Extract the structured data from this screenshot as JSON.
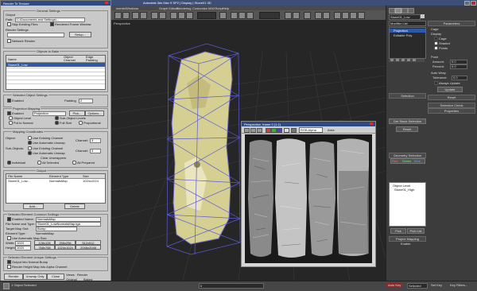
{
  "app": {
    "title": "Autodesk 3ds Max 9 SP2   |   Display   |   Stone01 3D",
    "title_prefix": "Stone01",
    "title_path": "ments\\Windows"
  },
  "menu": [
    "Graph Editors",
    "Rendering",
    "Customize",
    "MAXScript",
    "Help"
  ],
  "viewport": {
    "label": "Perspective"
  },
  "rtt": {
    "title": "Render To Texture",
    "general_settings": "General Settings",
    "output_label": "Output",
    "path_label": "Path:",
    "path_value": "C:\\Documents and Settings\\...",
    "skip_existing": "Skip Existing Files",
    "rendered_frame_window": "Rendered Frame Window",
    "render_settings": "Render Settings",
    "setup_btn": "Setup...",
    "network_render": "Network Render",
    "objects_to_bake": "Objects to Bake",
    "bake_headers": [
      "Name",
      "Object Channel",
      "Edge Padding"
    ],
    "bake_rows": [
      "Stone01_Low",
      "",
      "",
      "",
      "",
      ""
    ],
    "selected_obj_settings": "Selected Object Settings",
    "enabled": "Enabled",
    "padding_label": "Padding",
    "padding_value": "2",
    "projection_mapping": "Projection Mapping",
    "projection_label": "Projection",
    "pick_btn": "Pick...",
    "options_btn": "Options...",
    "object_level": "Object Level",
    "sub_object_levels": "Sub-Object Levels",
    "put_to_normal": "Put to Normal",
    "full_size": "Full Size",
    "proportional": "Proportional",
    "mapping_coords": "Mapping Coordinates",
    "object_label": "Object:",
    "sub_objects_label": "Sub-Objects:",
    "use_existing": "Use Existing Channel",
    "use_automatic": "Use Automatic Unwrap",
    "channel_label": "Channel:",
    "channel_value": "3",
    "clear_unwrappers": "Clear Unwrappers",
    "individual": "Individual",
    "all_selected": "All Selected",
    "all_prepared": "All Prepared",
    "output_headers": [
      "File Name",
      "Element Type",
      "Size"
    ],
    "output_rows": [
      [
        "Stone01_Low...",
        "NormalsMap",
        "1024x1024"
      ]
    ],
    "add_btn": "Add...",
    "delete_btn": "Delete",
    "selected_element_settings": "Selected Element Common Settings",
    "name_label": "Name:",
    "name_value": "NormalsMap",
    "file_name_type_label": "File Name and Type:",
    "file_name_value": "Stone01_LowNormalsMap.tga",
    "target_map_slot": "Target Map Slot:",
    "target_map_value": "Bump",
    "element_type_label": "Element Type:",
    "element_type_value": "NormalsMap",
    "use_auto_map_size": "Use Automatic Map Size",
    "width_label": "Width:",
    "width_value": "1024",
    "height_label": "Height:",
    "height_value": "1024",
    "size_presets": [
      "128x128",
      "256x256",
      "512x512",
      "768x768",
      "1024x1024",
      "2048x2048"
    ],
    "selected_element_unique": "Selected Element Unique Settings",
    "output_normal_bump": "Output into Normal Bump",
    "render_height_map": "Render Height Map into Alpha Channel",
    "bottom_buttons": [
      "Render",
      "Unwrap Only",
      "Close"
    ],
    "views_label": "Views",
    "render_label": "Render",
    "original_label": "Original",
    "baked_label": "Baked"
  },
  "right_panel": {
    "object_name": "Stone01_Low",
    "modifier_list": "Modifier List",
    "stack_items": [
      "Projection",
      "Editable Poly"
    ],
    "params_title": "Parameters",
    "cage": "Cage",
    "display": "Display",
    "shaded": "Shaded",
    "points": "Points",
    "push": "Push",
    "amount_label": "Amount:",
    "amount_value": "0.0",
    "percent_label": "Percent:",
    "percent_value": "0.0",
    "auto_wrap": "Auto Wrap",
    "tolerance_label": "Tolerance:",
    "tolerance_value": "0.0",
    "always_update": "Always Update",
    "update_btn": "Update",
    "selection": "Selection",
    "get_stack_selection": "Get Stack Selection",
    "reset": "Reset",
    "selection_check": "Selection Check",
    "properties": "Properties",
    "geometry_selection": "Geometry Selection",
    "pick_btn": "Pick",
    "pick_list_btn": "Pick List",
    "rgb_values": [
      "Red",
      "Green",
      "Blue"
    ],
    "object_level": "Object Level",
    "list_items": [
      "Object Level",
      "Stone01_High"
    ],
    "project_mapping": "Project Mapping",
    "enable": "Enable",
    "rollout_right": [
      "Cage",
      "Selection Check",
      "Properties"
    ]
  },
  "perspective_window": {
    "title": "Perspective, frame 0 (1:1)",
    "channel_label": "RGB Alpha",
    "area": "Area"
  },
  "status": {
    "left": "1 Object Selected",
    "right_items": [
      "Auto Key",
      "Selected",
      "Set Key",
      "Key Filters..."
    ],
    "frame": "0"
  }
}
